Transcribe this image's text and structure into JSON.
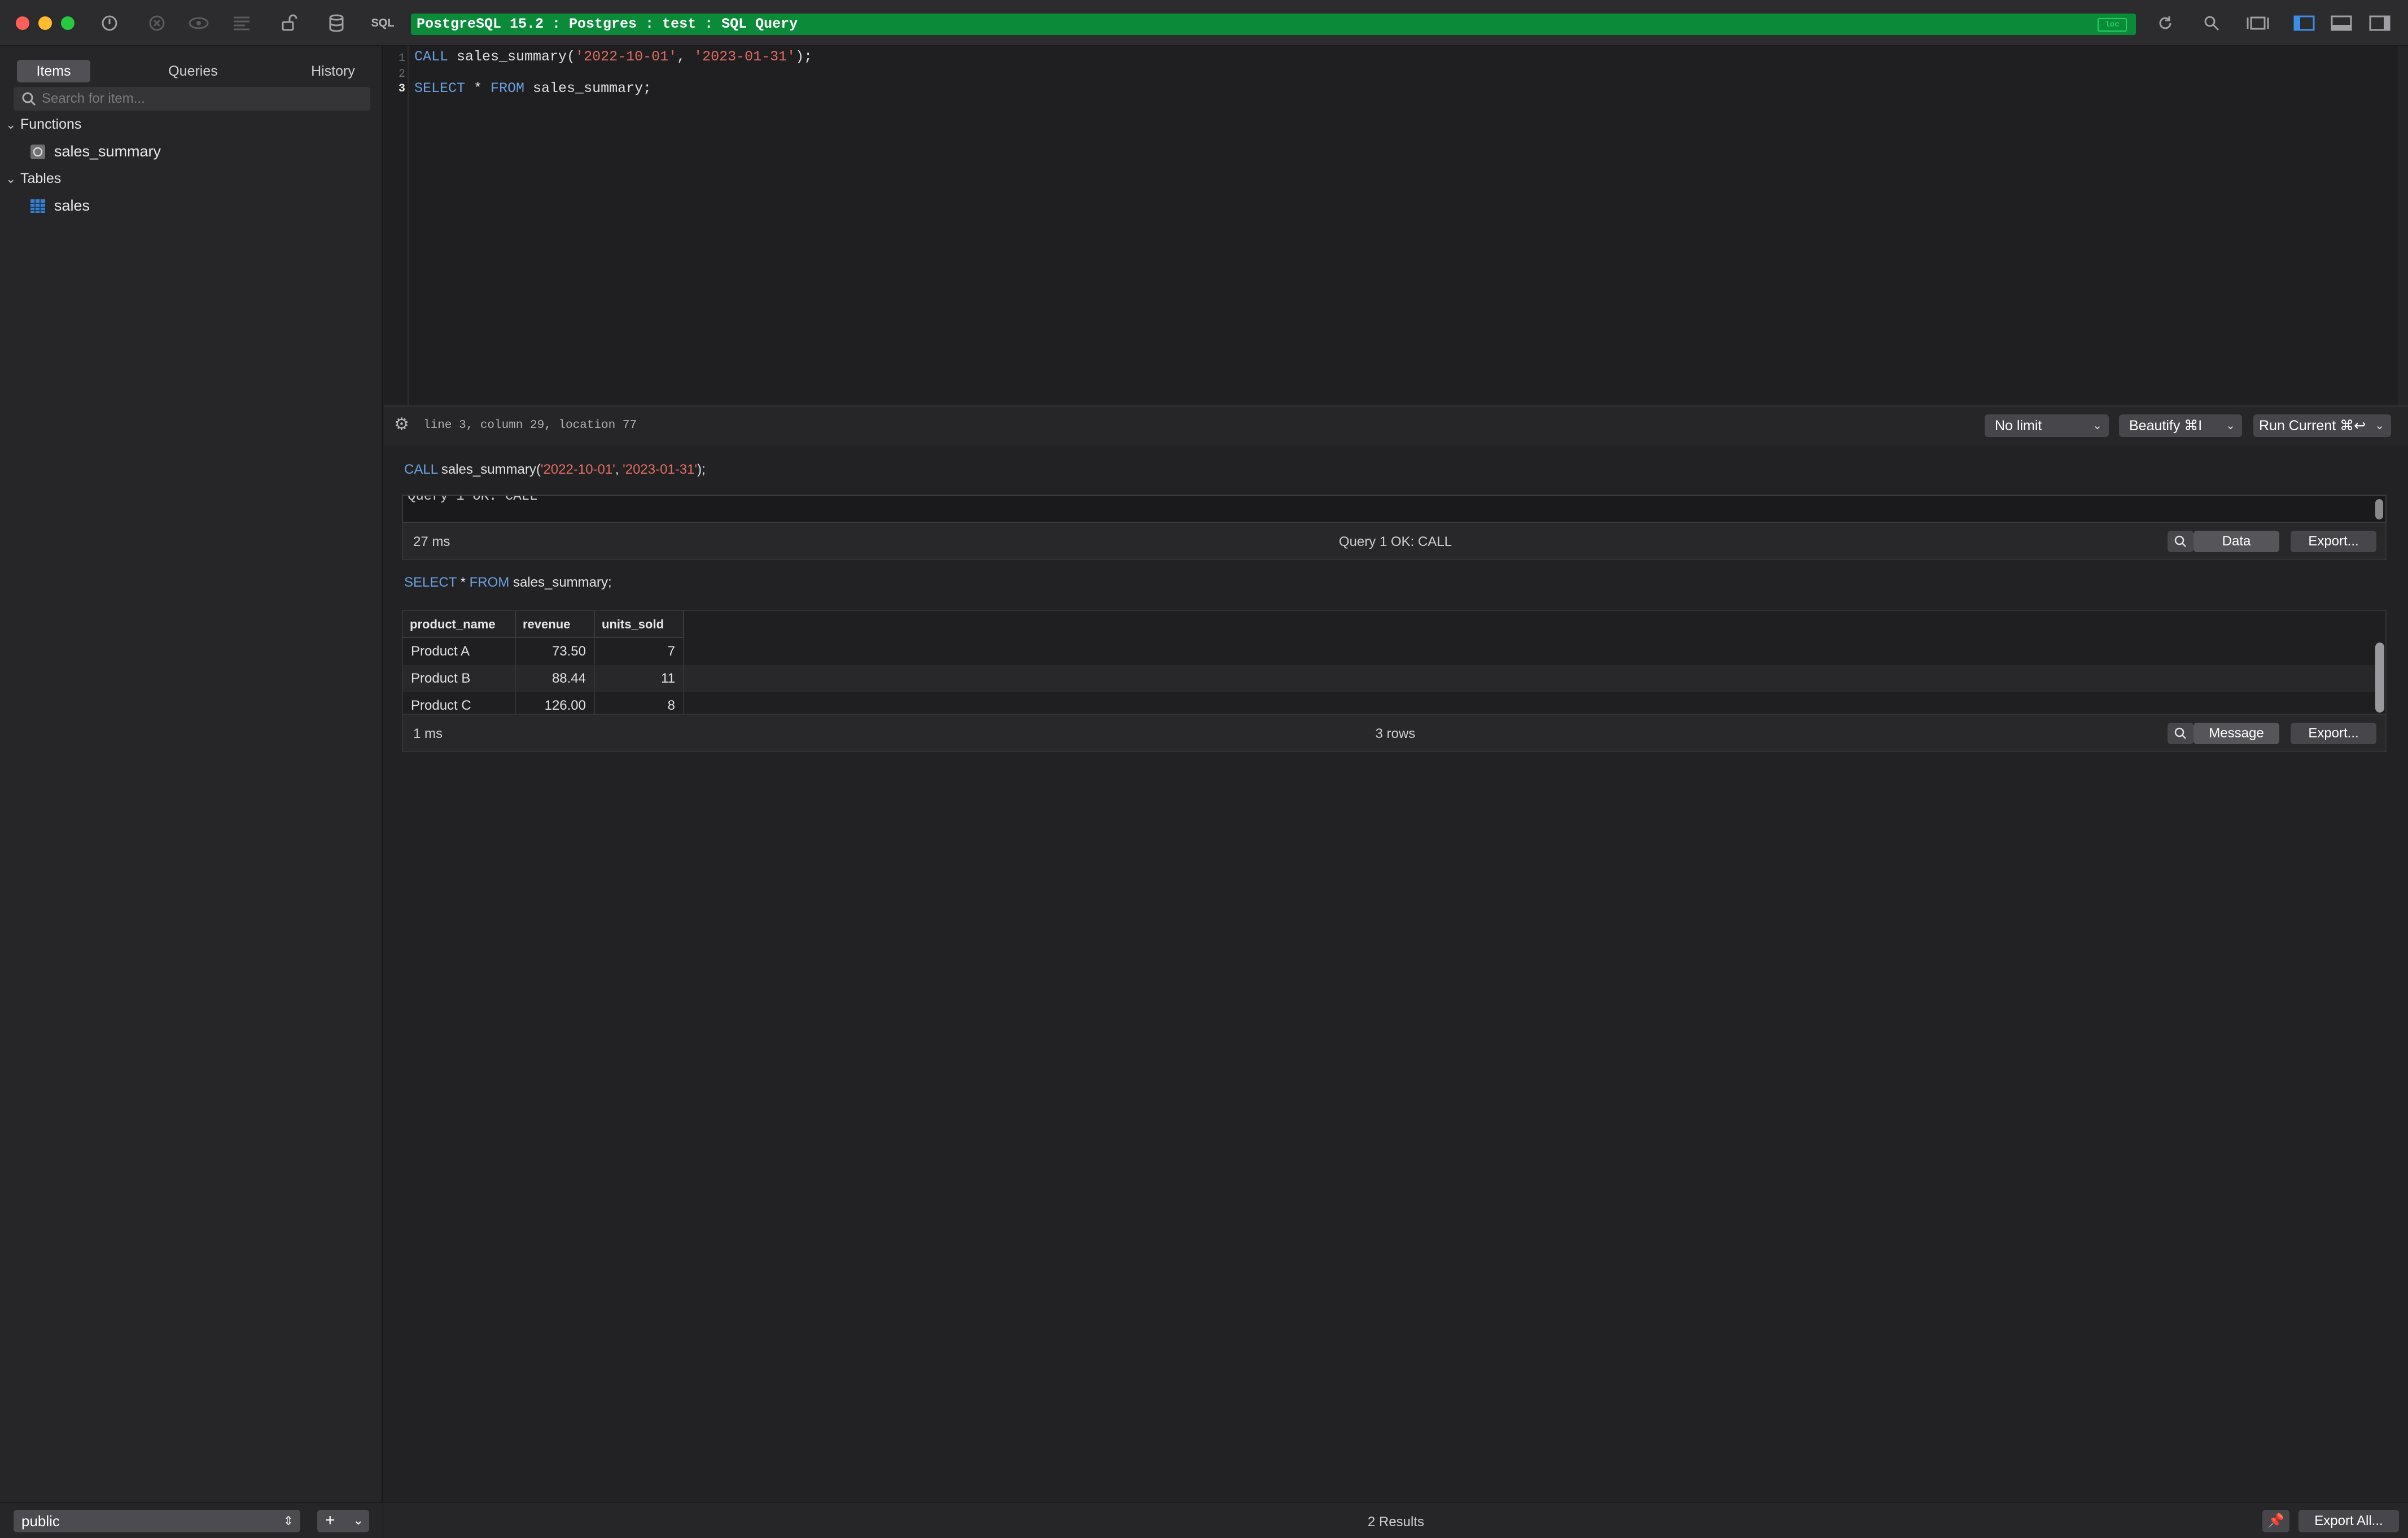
{
  "titlebar": {
    "connection": "PostgreSQL 15.2 : Postgres : test : SQL Query",
    "badge": "loc",
    "sql_label": "SQL"
  },
  "sidebar": {
    "tabs": [
      "Items",
      "Queries",
      "History"
    ],
    "active_tab": "Items",
    "search_placeholder": "Search for item...",
    "groups": [
      {
        "label": "Functions",
        "items": [
          "sales_summary"
        ]
      },
      {
        "label": "Tables",
        "items": [
          "sales"
        ]
      }
    ],
    "schema": "public",
    "add_label": "+"
  },
  "editor": {
    "line_numbers": [
      "1",
      "2",
      "3"
    ],
    "lines": [
      {
        "kw": "CALL",
        "rest1": " sales_summary(",
        "s1": "'2022-10-01'",
        "sep": ", ",
        "s2": "'2023-01-31'",
        "end": ");"
      },
      {},
      {
        "kw1": "SELECT",
        "mid": " * ",
        "kw2": "FROM",
        "rest": " sales_summary;"
      }
    ],
    "cursor_position": "line 3, column 29, location 77"
  },
  "toolbar": {
    "limit": "No limit",
    "beautify": "Beautify ⌘I",
    "run": "Run Current ⌘↩"
  },
  "results": [
    {
      "sql_kw": "CALL",
      "sql_rest": " sales_summary(",
      "sql_s1": "'2022-10-01'",
      "sql_sep": ", ",
      "sql_s2": "'2023-01-31'",
      "sql_end": ");",
      "message": "Query 1 OK: CALL",
      "time": "27 ms",
      "status": "Query 1 OK: CALL",
      "toggle_label": "Data",
      "export_label": "Export..."
    },
    {
      "sql_kw1": "SELECT",
      "sql_mid": " * ",
      "sql_kw2": "FROM",
      "sql_rest": " sales_summary;",
      "columns": [
        "product_name",
        "revenue",
        "units_sold"
      ],
      "rows": [
        [
          "Product A",
          "73.50",
          "7"
        ],
        [
          "Product B",
          "88.44",
          "11"
        ],
        [
          "Product C",
          "126.00",
          "8"
        ]
      ],
      "time": "1 ms",
      "status": "3 rows",
      "toggle_label": "Message",
      "export_label": "Export..."
    }
  ],
  "footer": {
    "results_count": "2 Results",
    "export_all": "Export All..."
  },
  "colors": {
    "connection_bar": "#0b8a3a",
    "keyword": "#6aa0e0",
    "string": "#e06c60"
  },
  "icons": [
    "close-icon",
    "minimize-icon",
    "zoom-icon",
    "connection-icon",
    "stop-icon",
    "preview-icon",
    "list-icon",
    "lock-icon",
    "database-icon",
    "refresh-icon",
    "search-icon",
    "layout-icons",
    "function-icon",
    "table-icon",
    "gear-icon",
    "pin-icon"
  ]
}
